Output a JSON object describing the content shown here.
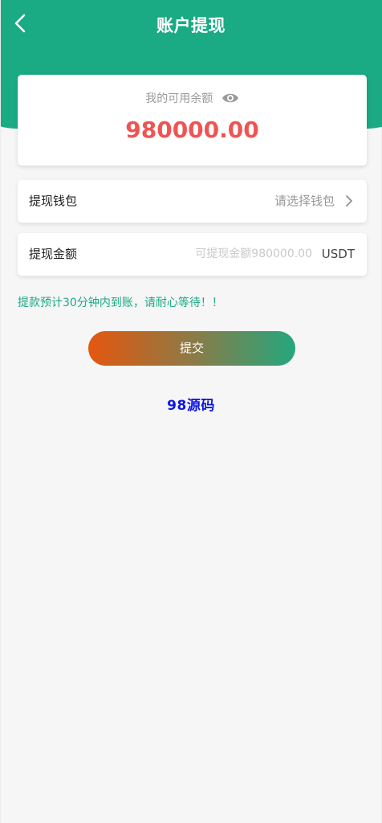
{
  "header": {
    "title": "账户提现",
    "back_icon": "chevron-left-icon"
  },
  "balance": {
    "label": "我的可用余额",
    "amount": "980000.00",
    "visibility_icon": "eye-icon"
  },
  "wallet_row": {
    "label": "提现钱包",
    "value": "请选择钱包",
    "arrow_icon": "chevron-right-icon"
  },
  "amount_row": {
    "label": "提现金额",
    "placeholder": "可提现金额980000.00",
    "value": "",
    "unit": "USDT"
  },
  "notice": "提款预计30分钟内到账，请耐心等待！！",
  "submit_label": "提交",
  "watermark": "98源码",
  "colors": {
    "brand": "#1aaa84",
    "balance_amount": "#ef5453",
    "gradient_start": "#e4570f",
    "gradient_end": "#24a77e",
    "watermark": "#0c16e6"
  }
}
